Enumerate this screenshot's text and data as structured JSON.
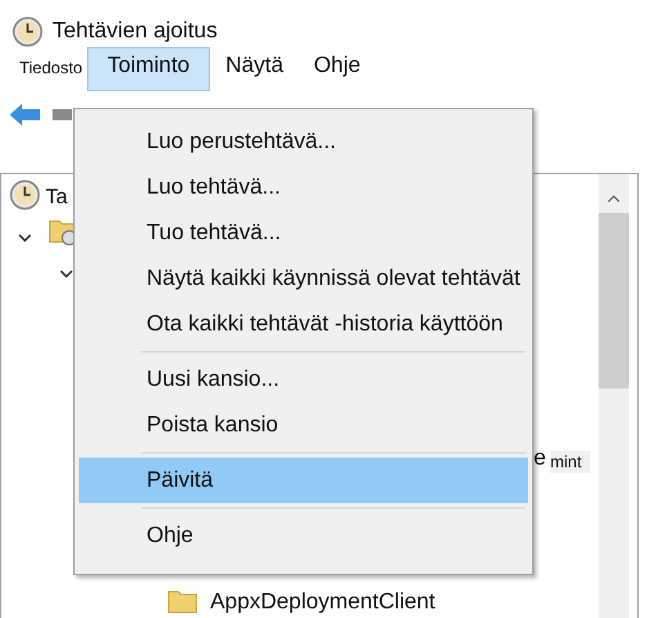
{
  "window": {
    "title": "Tehtävien ajoitus"
  },
  "menubar": [
    {
      "label": "Tiedosto",
      "selected": false,
      "small": true
    },
    {
      "label": "Toiminto",
      "selected": true,
      "small": false
    },
    {
      "label": "Näytä",
      "selected": false,
      "small": false
    },
    {
      "label": "Ohje",
      "selected": false,
      "small": false
    }
  ],
  "tree": {
    "root": "Ta",
    "fragment_1": "e",
    "fragment_2": "mint",
    "folder_label": "AppxDeploymentClient"
  },
  "menu": [
    {
      "kind": "item",
      "label": "Luo perustehtävä...",
      "selected": false
    },
    {
      "kind": "item",
      "label": "Luo tehtävä...",
      "selected": false
    },
    {
      "kind": "item",
      "label": "Tuo tehtävä...",
      "selected": false
    },
    {
      "kind": "item",
      "label": "Näytä kaikki käynnissä olevat tehtävät",
      "selected": false
    },
    {
      "kind": "item",
      "label": "Ota kaikki tehtävät -historia käyttöön",
      "selected": false
    },
    {
      "kind": "separator"
    },
    {
      "kind": "item",
      "label": "Uusi kansio...",
      "selected": false
    },
    {
      "kind": "item",
      "label": "Poista kansio",
      "selected": false
    },
    {
      "kind": "separator"
    },
    {
      "kind": "item",
      "label": "Päivitä",
      "selected": true
    },
    {
      "kind": "separator"
    },
    {
      "kind": "item",
      "label": "Ohje",
      "selected": false
    }
  ]
}
